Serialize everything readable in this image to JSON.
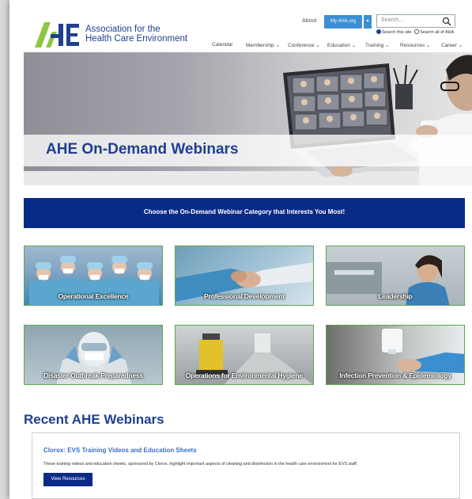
{
  "header": {
    "logo_line1": "Association for the",
    "logo_line2": "Health Care Environment",
    "about_label": "About",
    "myahe_label": "My AHA.org",
    "search_placeholder": "Search...",
    "scope_this_site": "Search this site",
    "scope_all_aha": "Search all of AHA",
    "nav": [
      {
        "label": "Calendar"
      },
      {
        "label": "Membership ⌄"
      },
      {
        "label": "Conference ⌄"
      },
      {
        "label": "Education ⌄"
      },
      {
        "label": "Training ⌄"
      },
      {
        "label": "Resources ⌄"
      },
      {
        "label": "Career ⌄"
      }
    ]
  },
  "hero": {
    "title": "AHE On-Demand Webinars"
  },
  "banner": {
    "text": "Choose the On-Demand Webinar Category that Interests You Most!"
  },
  "categories": [
    {
      "label": "Operational Excellence"
    },
    {
      "label": "Professional Development"
    },
    {
      "label": "Leadership"
    },
    {
      "label": "Disaster Outbreak Preparedness"
    },
    {
      "label": "Operations for Environmental Hygiene"
    },
    {
      "label": "Infection Prevention & Epidemiology"
    }
  ],
  "recent": {
    "heading": "Recent AHE Webinars",
    "card_title": "Clorox: EVS Training Videos and Education Sheets",
    "card_description": "These training videos and education sheets, sponsored by Clorox, highlight important aspects of cleaning and disinfection in the health care environment for EVS staff.",
    "card_button": "View Resources"
  },
  "colors": {
    "brand_navy": "#0a2a87",
    "brand_blue": "#1f3f8f",
    "link_blue": "#3c6fc8",
    "button_blue": "#3c8fd6",
    "tile_border_green": "#5fa64e",
    "logo_green": "#8dc63f"
  }
}
